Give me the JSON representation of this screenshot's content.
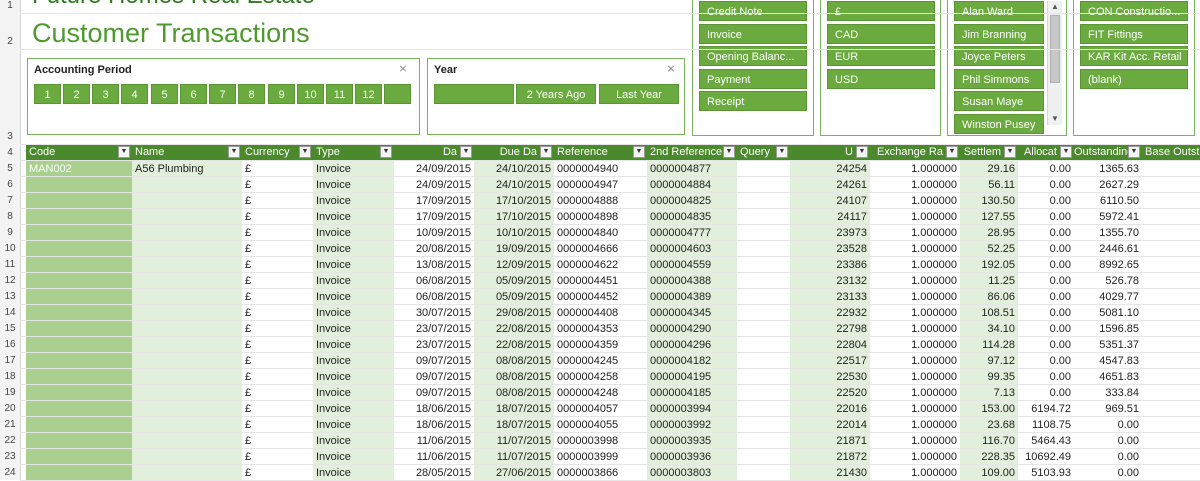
{
  "header": {
    "title": "Future Homes Real Estate",
    "subtitle": "Customer Transactions"
  },
  "row_numbers": [
    "1",
    "2",
    "3",
    "4",
    "5",
    "6",
    "7",
    "8",
    "9",
    "10",
    "11",
    "12",
    "13",
    "14",
    "15",
    "16",
    "17",
    "18",
    "19",
    "20",
    "21",
    "22",
    "23",
    "24"
  ],
  "slicers": {
    "accounting_period": {
      "title": "Accounting Period",
      "items": [
        "1",
        "2",
        "3",
        "4",
        "5",
        "6",
        "7",
        "8",
        "9",
        "10",
        "11",
        "12",
        ""
      ]
    },
    "year": {
      "title": "Year",
      "items": [
        "",
        "2 Years Ago",
        "Last Year"
      ]
    },
    "type": {
      "items": [
        "Credit Note",
        "Invoice",
        "Opening Balanc...",
        "Payment",
        "Receipt"
      ]
    },
    "currency": {
      "items": [
        "£",
        "CAD",
        "EUR",
        "USD"
      ]
    },
    "user": {
      "items": [
        "Alan Ward",
        "Jim Branning",
        "Joyce Peters",
        "Phil Simmons",
        "Susan Maye",
        "Winston Pusey"
      ]
    },
    "department": {
      "items": [
        "CON Constructio...",
        "FIT Fittings",
        "KAR Kit Acc. Retail",
        "(blank)"
      ]
    }
  },
  "table": {
    "columns": [
      "Code",
      "Name",
      "Currency",
      "Type",
      "Da",
      "Due Da",
      "Reference",
      "2nd Reference",
      "Query",
      "U",
      "Exchange Ra",
      "Settlem",
      "Allocat",
      "Outstanding",
      "Base Outst"
    ],
    "rows": [
      {
        "code": "MAN002",
        "name": "A56 Plumbing",
        "currency": "£",
        "type": "Invoice",
        "date": "24/09/2015",
        "due": "24/10/2015",
        "ref": "0000004940",
        "ref2": "0000004877",
        "query": "",
        "u": "24254",
        "rate": "1.000000",
        "settle": "29.16",
        "alloc": "0.00",
        "out": "1365.63"
      },
      {
        "code": "",
        "name": "",
        "currency": "£",
        "type": "Invoice",
        "date": "24/09/2015",
        "due": "24/10/2015",
        "ref": "0000004947",
        "ref2": "0000004884",
        "query": "",
        "u": "24261",
        "rate": "1.000000",
        "settle": "56.11",
        "alloc": "0.00",
        "out": "2627.29"
      },
      {
        "code": "",
        "name": "",
        "currency": "£",
        "type": "Invoice",
        "date": "17/09/2015",
        "due": "17/10/2015",
        "ref": "0000004888",
        "ref2": "0000004825",
        "query": "",
        "u": "24107",
        "rate": "1.000000",
        "settle": "130.50",
        "alloc": "0.00",
        "out": "6110.50"
      },
      {
        "code": "",
        "name": "",
        "currency": "£",
        "type": "Invoice",
        "date": "17/09/2015",
        "due": "17/10/2015",
        "ref": "0000004898",
        "ref2": "0000004835",
        "query": "",
        "u": "24117",
        "rate": "1.000000",
        "settle": "127.55",
        "alloc": "0.00",
        "out": "5972.41"
      },
      {
        "code": "",
        "name": "",
        "currency": "£",
        "type": "Invoice",
        "date": "10/09/2015",
        "due": "10/10/2015",
        "ref": "0000004840",
        "ref2": "0000004777",
        "query": "",
        "u": "23973",
        "rate": "1.000000",
        "settle": "28.95",
        "alloc": "0.00",
        "out": "1355.70"
      },
      {
        "code": "",
        "name": "",
        "currency": "£",
        "type": "Invoice",
        "date": "20/08/2015",
        "due": "19/09/2015",
        "ref": "0000004666",
        "ref2": "0000004603",
        "query": "",
        "u": "23528",
        "rate": "1.000000",
        "settle": "52.25",
        "alloc": "0.00",
        "out": "2446.61"
      },
      {
        "code": "",
        "name": "",
        "currency": "£",
        "type": "Invoice",
        "date": "13/08/2015",
        "due": "12/09/2015",
        "ref": "0000004622",
        "ref2": "0000004559",
        "query": "",
        "u": "23386",
        "rate": "1.000000",
        "settle": "192.05",
        "alloc": "0.00",
        "out": "8992.65"
      },
      {
        "code": "",
        "name": "",
        "currency": "£",
        "type": "Invoice",
        "date": "06/08/2015",
        "due": "05/09/2015",
        "ref": "0000004451",
        "ref2": "0000004388",
        "query": "",
        "u": "23132",
        "rate": "1.000000",
        "settle": "11.25",
        "alloc": "0.00",
        "out": "526.78"
      },
      {
        "code": "",
        "name": "",
        "currency": "£",
        "type": "Invoice",
        "date": "06/08/2015",
        "due": "05/09/2015",
        "ref": "0000004452",
        "ref2": "0000004389",
        "query": "",
        "u": "23133",
        "rate": "1.000000",
        "settle": "86.06",
        "alloc": "0.00",
        "out": "4029.77"
      },
      {
        "code": "",
        "name": "",
        "currency": "£",
        "type": "Invoice",
        "date": "30/07/2015",
        "due": "29/08/2015",
        "ref": "0000004408",
        "ref2": "0000004345",
        "query": "",
        "u": "22932",
        "rate": "1.000000",
        "settle": "108.51",
        "alloc": "0.00",
        "out": "5081.10"
      },
      {
        "code": "",
        "name": "",
        "currency": "£",
        "type": "Invoice",
        "date": "23/07/2015",
        "due": "22/08/2015",
        "ref": "0000004353",
        "ref2": "0000004290",
        "query": "",
        "u": "22798",
        "rate": "1.000000",
        "settle": "34.10",
        "alloc": "0.00",
        "out": "1596.85"
      },
      {
        "code": "",
        "name": "",
        "currency": "£",
        "type": "Invoice",
        "date": "23/07/2015",
        "due": "22/08/2015",
        "ref": "0000004359",
        "ref2": "0000004296",
        "query": "",
        "u": "22804",
        "rate": "1.000000",
        "settle": "114.28",
        "alloc": "0.00",
        "out": "5351.37"
      },
      {
        "code": "",
        "name": "",
        "currency": "£",
        "type": "Invoice",
        "date": "09/07/2015",
        "due": "08/08/2015",
        "ref": "0000004245",
        "ref2": "0000004182",
        "query": "",
        "u": "22517",
        "rate": "1.000000",
        "settle": "97.12",
        "alloc": "0.00",
        "out": "4547.83"
      },
      {
        "code": "",
        "name": "",
        "currency": "£",
        "type": "Invoice",
        "date": "09/07/2015",
        "due": "08/08/2015",
        "ref": "0000004258",
        "ref2": "0000004195",
        "query": "",
        "u": "22530",
        "rate": "1.000000",
        "settle": "99.35",
        "alloc": "0.00",
        "out": "4651.83"
      },
      {
        "code": "",
        "name": "",
        "currency": "£",
        "type": "Invoice",
        "date": "09/07/2015",
        "due": "08/08/2015",
        "ref": "0000004248",
        "ref2": "0000004185",
        "query": "",
        "u": "22520",
        "rate": "1.000000",
        "settle": "7.13",
        "alloc": "0.00",
        "out": "333.84"
      },
      {
        "code": "",
        "name": "",
        "currency": "£",
        "type": "Invoice",
        "date": "18/06/2015",
        "due": "18/07/2015",
        "ref": "0000004057",
        "ref2": "0000003994",
        "query": "",
        "u": "22016",
        "rate": "1.000000",
        "settle": "153.00",
        "alloc": "6194.72",
        "out": "969.51"
      },
      {
        "code": "",
        "name": "",
        "currency": "£",
        "type": "Invoice",
        "date": "18/06/2015",
        "due": "18/07/2015",
        "ref": "0000004055",
        "ref2": "0000003992",
        "query": "",
        "u": "22014",
        "rate": "1.000000",
        "settle": "23.68",
        "alloc": "1108.75",
        "out": "0.00"
      },
      {
        "code": "",
        "name": "",
        "currency": "£",
        "type": "Invoice",
        "date": "11/06/2015",
        "due": "11/07/2015",
        "ref": "0000003998",
        "ref2": "0000003935",
        "query": "",
        "u": "21871",
        "rate": "1.000000",
        "settle": "116.70",
        "alloc": "5464.43",
        "out": "0.00"
      },
      {
        "code": "",
        "name": "",
        "currency": "£",
        "type": "Invoice",
        "date": "11/06/2015",
        "due": "11/07/2015",
        "ref": "0000003999",
        "ref2": "0000003936",
        "query": "",
        "u": "21872",
        "rate": "1.000000",
        "settle": "228.35",
        "alloc": "10692.49",
        "out": "0.00"
      },
      {
        "code": "",
        "name": "",
        "currency": "£",
        "type": "Invoice",
        "date": "28/05/2015",
        "due": "27/06/2015",
        "ref": "0000003866",
        "ref2": "0000003803",
        "query": "",
        "u": "21430",
        "rate": "1.000000",
        "settle": "109.00",
        "alloc": "5103.93",
        "out": "0.00"
      }
    ]
  },
  "colors": {
    "header_green": "#4b8a2c",
    "slicer_green": "#6aaa3f",
    "light_green": "#a9d08e",
    "pale_green": "#e2efda"
  }
}
